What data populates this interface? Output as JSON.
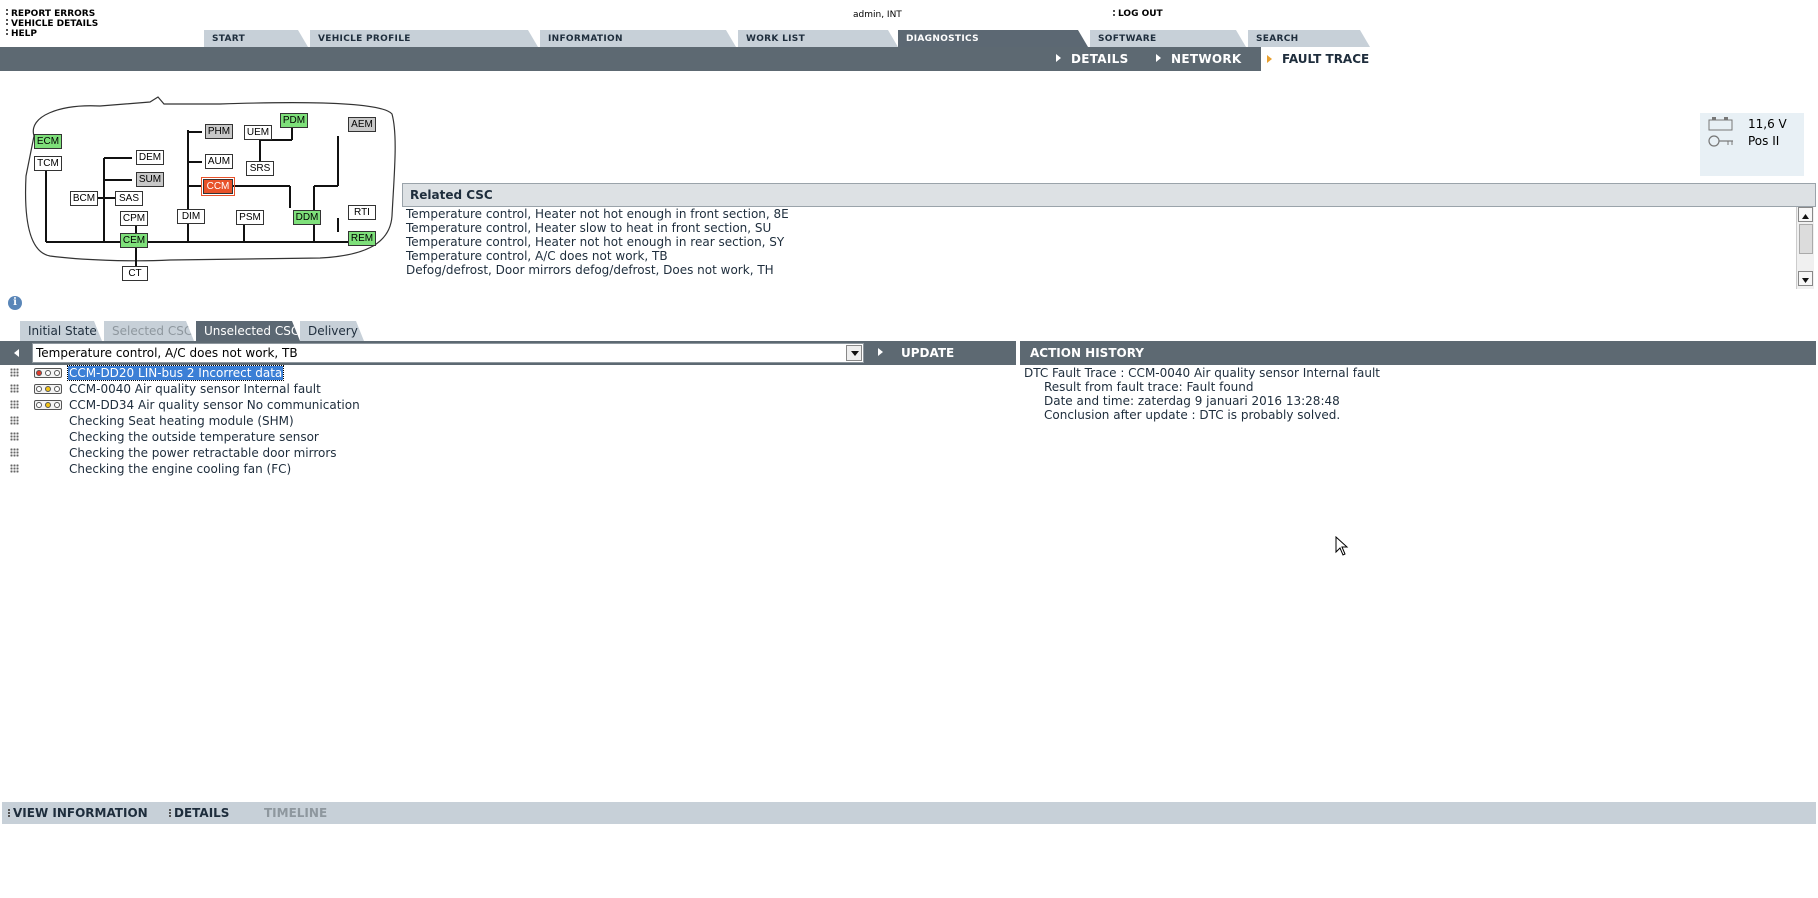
{
  "top_links": [
    "REPORT ERRORS",
    "VEHICLE DETAILS",
    "HELP"
  ],
  "user": "admin, INT",
  "logout": "LOG OUT",
  "tabs": [
    {
      "label": "START",
      "active": false
    },
    {
      "label": "VEHICLE PROFILE",
      "active": false
    },
    {
      "label": "INFORMATION",
      "active": false
    },
    {
      "label": "WORK LIST",
      "active": false
    },
    {
      "label": "DIAGNOSTICS",
      "active": true
    },
    {
      "label": "SOFTWARE",
      "active": false
    },
    {
      "label": "SEARCH",
      "active": false
    }
  ],
  "subnav": {
    "details": "DETAILS",
    "network": "NETWORK",
    "fault_trace": "FAULT TRACE"
  },
  "network": {
    "nodes": [
      {
        "label": "ECM",
        "state": "green"
      },
      {
        "label": "TCM",
        "state": "normal"
      },
      {
        "label": "DEM",
        "state": "normal"
      },
      {
        "label": "SUM",
        "state": "gray"
      },
      {
        "label": "BCM",
        "state": "normal"
      },
      {
        "label": "SAS",
        "state": "normal"
      },
      {
        "label": "CPM",
        "state": "normal"
      },
      {
        "label": "CEM",
        "state": "green"
      },
      {
        "label": "CT",
        "state": "normal"
      },
      {
        "label": "PHM",
        "state": "gray"
      },
      {
        "label": "AUM",
        "state": "normal"
      },
      {
        "label": "CCM",
        "state": "red"
      },
      {
        "label": "DIM",
        "state": "normal"
      },
      {
        "label": "UEM",
        "state": "normal"
      },
      {
        "label": "PDM",
        "state": "green"
      },
      {
        "label": "SRS",
        "state": "normal"
      },
      {
        "label": "PSM",
        "state": "normal"
      },
      {
        "label": "DDM",
        "state": "green"
      },
      {
        "label": "AEM",
        "state": "gray"
      },
      {
        "label": "RTI",
        "state": "normal"
      },
      {
        "label": "REM",
        "state": "green"
      }
    ]
  },
  "battery": {
    "voltage": "11,6 V",
    "ignition": "Pos II"
  },
  "related_csc": {
    "title": "Related CSC",
    "items": [
      "Temperature control, Heater not hot enough in front section, 8E",
      "Temperature control, Heater slow to heat in front section, SU",
      "Temperature control, Heater not hot enough in rear section, SY",
      "Temperature control, A/C does not work, TB",
      "Defog/defrost, Door mirrors defog/defrost, Does not work, TH"
    ]
  },
  "subtabs": [
    {
      "label": "Initial State",
      "state": "normal"
    },
    {
      "label": "Selected CSC",
      "state": "disabled"
    },
    {
      "label": "Unselected CSC",
      "state": "active"
    },
    {
      "label": "Delivery",
      "state": "normal"
    }
  ],
  "fault_select": {
    "value": "Temperature control, A/C does not work, TB"
  },
  "update_label": "UPDATE",
  "action_history_title": "ACTION HISTORY",
  "faults": [
    {
      "label": "CCM-DD20 LIN-bus 2 Incorrect data",
      "lights": "red",
      "selected": true
    },
    {
      "label": "CCM-0040 Air quality sensor Internal fault",
      "lights": "yellow",
      "selected": false
    },
    {
      "label": "CCM-DD34 Air quality sensor No communication",
      "lights": "yellow",
      "selected": false
    },
    {
      "label": "Checking Seat heating module (SHM)",
      "lights": "none",
      "selected": false
    },
    {
      "label": "Checking the outside temperature sensor",
      "lights": "none",
      "selected": false
    },
    {
      "label": "Checking the power retractable door mirrors",
      "lights": "none",
      "selected": false
    },
    {
      "label": "Checking the engine cooling fan (FC)",
      "lights": "none",
      "selected": false
    }
  ],
  "history": {
    "title_line": "DTC Fault Trace :  CCM-0040 Air quality sensor Internal fault",
    "result": "Result from fault trace: Fault found",
    "datetime": "Date and time: zaterdag 9 januari 2016 13:28:48",
    "conclusion": "Conclusion after update : DTC is probably solved."
  },
  "bottom": {
    "view_information": "VIEW INFORMATION",
    "details": "DETAILS",
    "timeline": "TIMELINE"
  }
}
